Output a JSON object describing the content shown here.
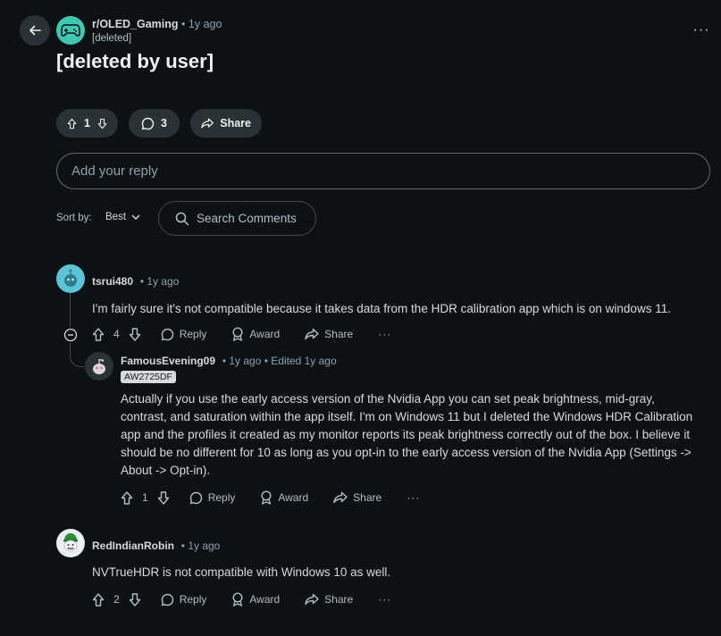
{
  "post": {
    "subreddit": "r/OLED_Gaming",
    "age": "1y ago",
    "author": "[deleted]",
    "title": "[deleted by user]",
    "votes": "1",
    "comments": "3",
    "share_label": "Share",
    "more": "···"
  },
  "reply": {
    "placeholder": "Add your reply"
  },
  "sort": {
    "label": "Sort by:",
    "value": "Best",
    "search_placeholder": "Search Comments"
  },
  "comments": [
    {
      "author": "tsrui480",
      "age": "1y ago",
      "text": "I'm fairly sure it's not compatible because it takes data from the HDR calibration app which is on windows 11.",
      "votes": "4",
      "reply": "Reply",
      "award": "Award",
      "share": "Share",
      "more": "···"
    },
    {
      "author": "FamousEvening09",
      "age": "1y ago",
      "edited": "Edited 1y ago",
      "flair": "AW2725DF",
      "text": "Actually if you use the early access version of the Nvidia App you can set peak brightness, mid-gray, contrast, and saturation within the app itself. I'm on Windows 11 but I deleted the Windows HDR Calibration app and the profiles it created as my monitor reports its peak brightness correctly out of the box. I believe it should be no different for 10 as long as you opt-in to the early access version of the Nvidia App (Settings -> About -> Opt-in).",
      "votes": "1",
      "reply": "Reply",
      "award": "Award",
      "share": "Share",
      "more": "···"
    },
    {
      "author": "RedIndianRobin",
      "age": "1y ago",
      "text": "NVTrueHDR is not compatible with Windows 10 as well.",
      "votes": "2",
      "reply": "Reply",
      "award": "Award",
      "share": "Share",
      "more": "···"
    }
  ],
  "colors": {
    "background": "#0e1113",
    "pill": "#2a3236",
    "subreddit_icon": "#3fc7b1",
    "avatar_1": "#5bc4d6"
  }
}
